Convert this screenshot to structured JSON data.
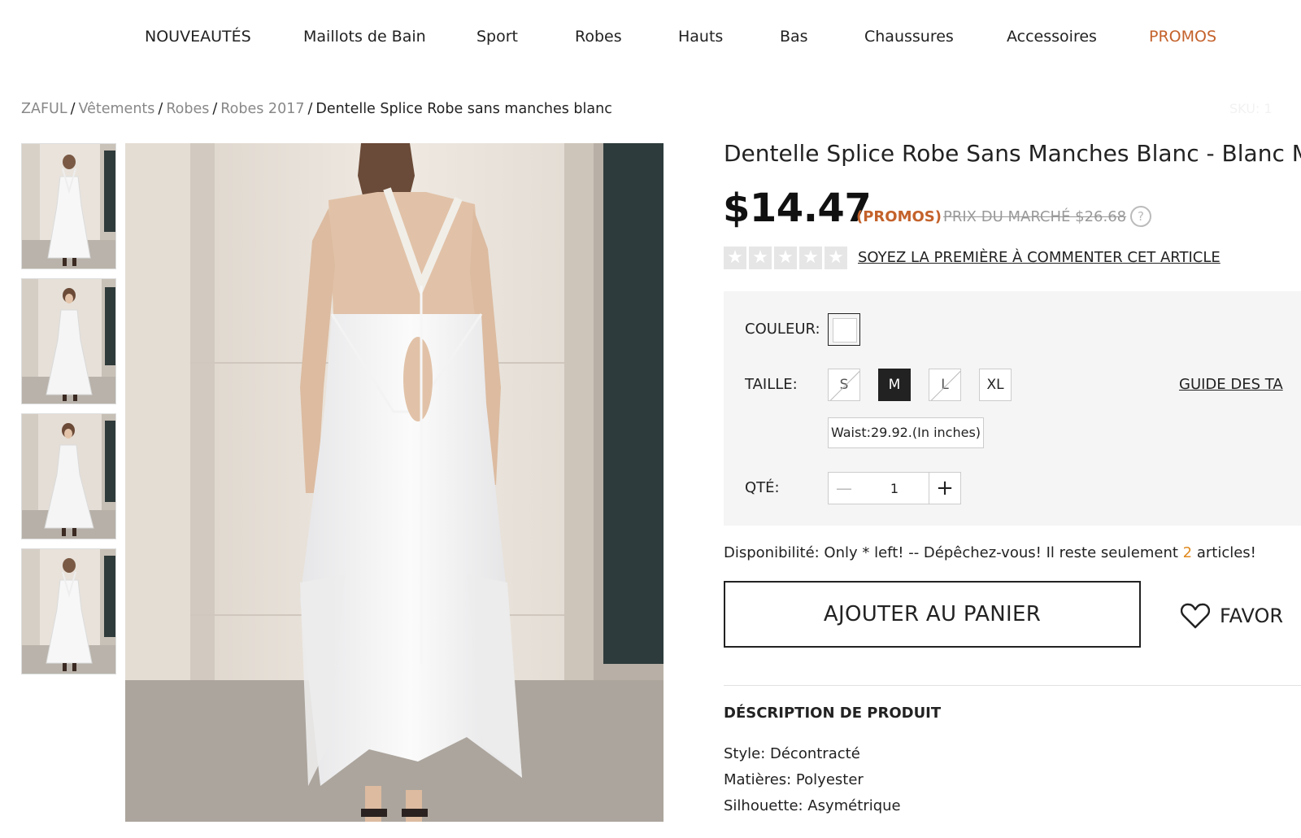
{
  "nav": {
    "items": [
      {
        "label": "NOUVEAUTÉS"
      },
      {
        "label": "Maillots de Bain"
      },
      {
        "label": "Sport"
      },
      {
        "label": "Robes"
      },
      {
        "label": "Hauts"
      },
      {
        "label": "Bas"
      },
      {
        "label": "Chaussures"
      },
      {
        "label": "Accessoires"
      },
      {
        "label": "PROMOS"
      }
    ],
    "promo_color": "#c4622b"
  },
  "breadcrumb": {
    "items": [
      "ZAFUL",
      "Vêtements",
      "Robes",
      "Robes 2017"
    ],
    "current": "Dentelle Splice Robe sans manches blanc",
    "separator": "/"
  },
  "sku": "SKU: 1",
  "gallery": {
    "thumb_icons": [
      "dress-back-thumbnail",
      "dress-front-thumbnail",
      "dress-front-thumbnail",
      "dress-back-thumbnail"
    ],
    "main_icon": "dress-back-photo"
  },
  "product": {
    "title": "Dentelle Splice Robe Sans Manches Blanc - Blanc M",
    "price": "$14.47",
    "promo_tag": "(PROMOS)",
    "market_price": "PRIX DU MARCHÉ $26.68",
    "help_icon_glyph": "?",
    "rating_stars": 5,
    "rating_value": 0,
    "review_link": "SOYEZ LA PREMIÈRE À COMMENTER CET ARTICLE",
    "accent_color": "#c4622b"
  },
  "options": {
    "color_label": "COULEUR:",
    "selected_color": "#ffffff",
    "size_label": "TAILLE:",
    "sizes": [
      {
        "label": "S",
        "state": "disabled"
      },
      {
        "label": "M",
        "state": "selected"
      },
      {
        "label": "L",
        "state": "disabled"
      },
      {
        "label": "XL",
        "state": "available"
      }
    ],
    "size_guide": "GUIDE DES TA",
    "waist_info": "Waist:29.92.(In inches)",
    "qty_label": "QTÉ:",
    "qty_value": "1",
    "qty_minus": "—",
    "qty_plus": "+"
  },
  "availability": {
    "prefix": "Disponibilité: Only * left! -- Dépêchez-vous! Il reste seulement ",
    "count": "2",
    "suffix": " articles!",
    "count_color": "#e08a1e"
  },
  "actions": {
    "add_to_cart": "AJOUTER AU PANIER",
    "favorite": "FAVOR"
  },
  "description": {
    "title": "DÉSCRIPTION DE PRODUIT",
    "lines": [
      "Style: Décontracté",
      "Matières: Polyester",
      "Silhouette: Asymétrique"
    ]
  }
}
